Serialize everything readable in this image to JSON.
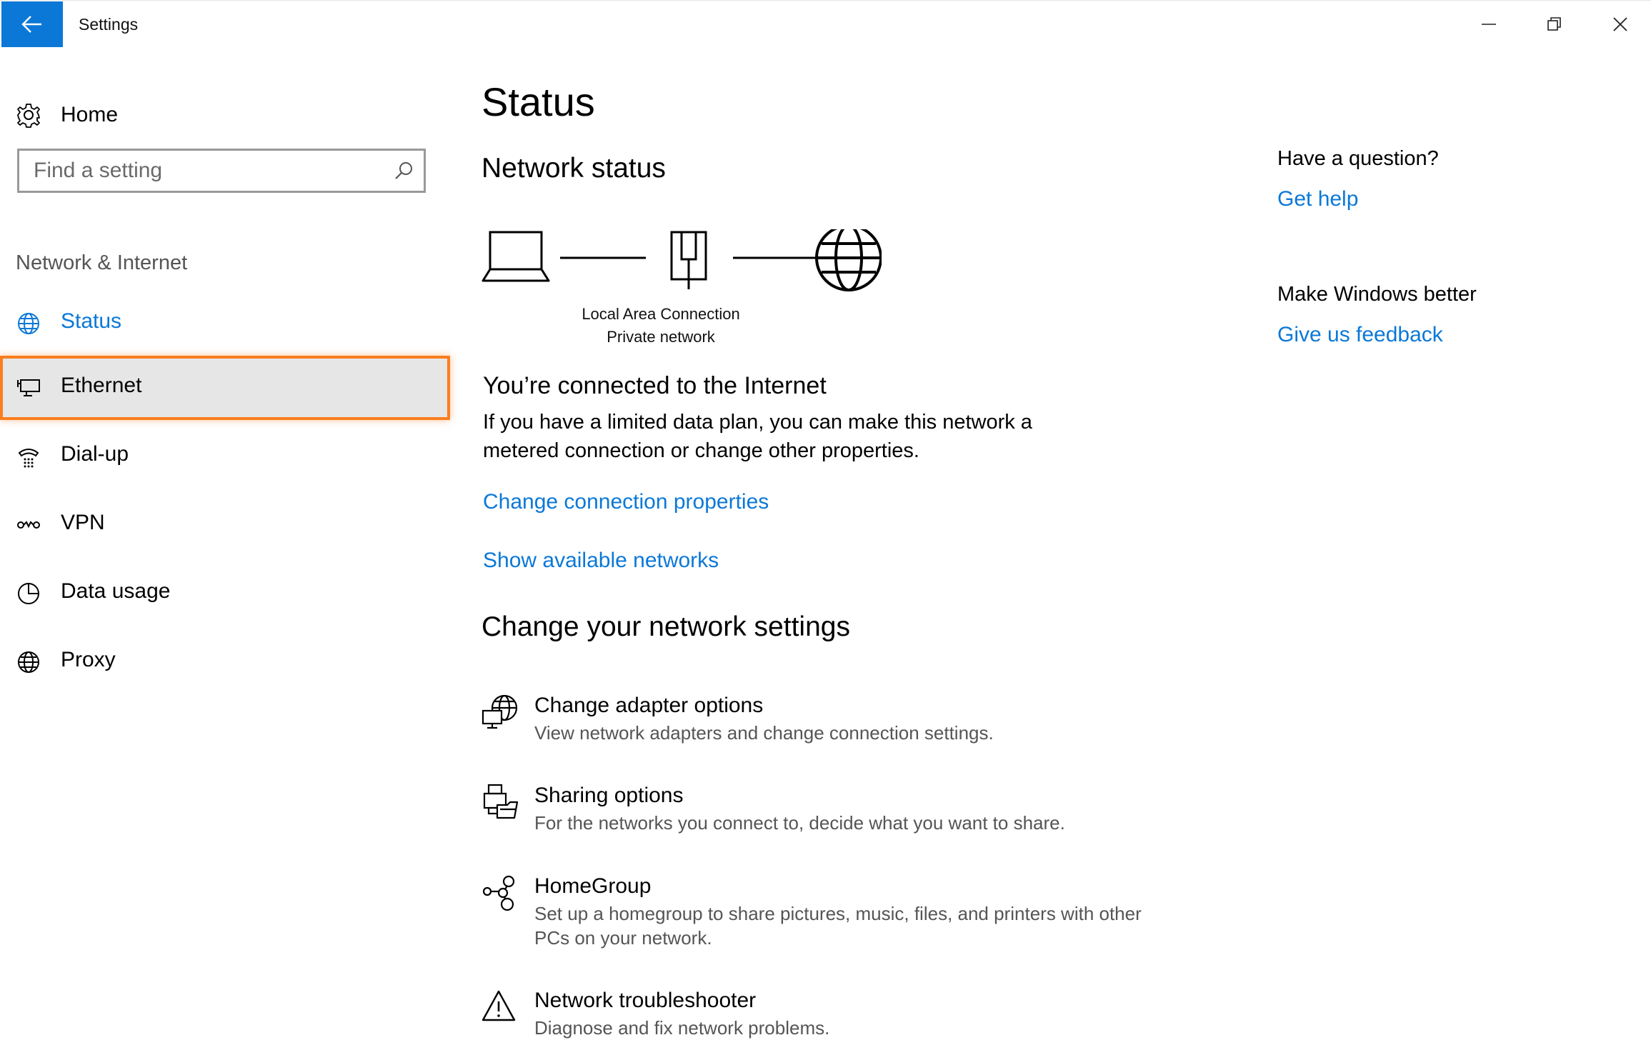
{
  "window": {
    "title": "Settings",
    "colors": {
      "accent": "#0b78d7",
      "highlight_border": "#fb7d1e",
      "selected_bg": "#e6e6e6"
    }
  },
  "sidebar": {
    "home_label": "Home",
    "search": {
      "placeholder": "Find a setting"
    },
    "section_label": "Network & Internet",
    "items": [
      {
        "label": "Status",
        "icon": "globe-status-icon",
        "state": "active"
      },
      {
        "label": "Ethernet",
        "icon": "ethernet-monitor-icon",
        "state": "selected"
      },
      {
        "label": "Dial-up",
        "icon": "dialup-icon"
      },
      {
        "label": "VPN",
        "icon": "vpn-icon"
      },
      {
        "label": "Data usage",
        "icon": "data-usage-icon"
      },
      {
        "label": "Proxy",
        "icon": "globe-icon"
      }
    ]
  },
  "main": {
    "title": "Status",
    "network_status_heading": "Network status",
    "diagram": {
      "connection_name": "Local Area Connection",
      "network_type": "Private network"
    },
    "connected_heading": "You’re connected to the Internet",
    "connected_description": "If you have a limited data plan, you can make this network a metered connection or change other properties.",
    "links": {
      "change_properties": "Change connection properties",
      "show_networks": "Show available networks"
    },
    "change_heading": "Change your network settings",
    "options": [
      {
        "title": "Change adapter options",
        "description": "View network adapters and change connection settings.",
        "icon": "adapter-icon"
      },
      {
        "title": "Sharing options",
        "description": "For the networks you connect to, decide what you want to share.",
        "icon": "sharing-icon"
      },
      {
        "title": "HomeGroup",
        "description": "Set up a homegroup to share pictures, music, files, and printers with other PCs on your network.",
        "icon": "homegroup-icon"
      },
      {
        "title": "Network troubleshooter",
        "description": "Diagnose and fix network problems.",
        "icon": "warning-icon"
      }
    ]
  },
  "right_panel": {
    "question": "Have a question?",
    "get_help": "Get help",
    "make_better": "Make Windows better",
    "feedback": "Give us feedback"
  }
}
